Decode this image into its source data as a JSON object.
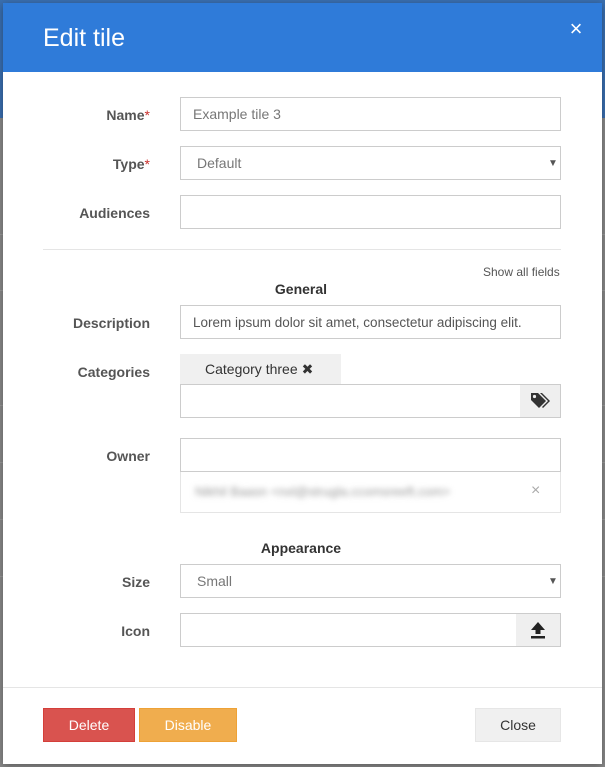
{
  "dialog": {
    "title": "Edit tile",
    "close_icon": "close-icon",
    "close_glyph": "×"
  },
  "form": {
    "name": {
      "label": "Name",
      "required_mark": "*",
      "value": "Example tile 3"
    },
    "type": {
      "label": "Type",
      "required_mark": "*",
      "selected": "Default"
    },
    "audiences": {
      "label": "Audiences",
      "value": ""
    },
    "show_all_fields": "Show all fields",
    "general_heading": "General",
    "description": {
      "label": "Description",
      "value": "Lorem ipsum dolor sit amet, consectetur adipiscing elit."
    },
    "categories": {
      "label": "Categories",
      "tags": [
        {
          "text": "Category three",
          "remove_glyph": "✖"
        }
      ],
      "input_value": "",
      "addon_icon": "tags-icon"
    },
    "owner": {
      "label": "Owner",
      "value": "",
      "suggestion": "Nikhil Baasn <nxl@strugla.ccomsreeft.com>",
      "suggestion_remove_glyph": "×"
    },
    "appearance_heading": "Appearance",
    "size": {
      "label": "Size",
      "selected": "Small"
    },
    "icon": {
      "label": "Icon",
      "value": "",
      "addon_icon": "upload-icon"
    }
  },
  "footer": {
    "delete_label": "Delete",
    "disable_label": "Disable",
    "close_label": "Close"
  },
  "colors": {
    "header": "#2f7bd9",
    "danger": "#d9534f",
    "warning": "#f0ad4e",
    "required": "#c9302c"
  }
}
